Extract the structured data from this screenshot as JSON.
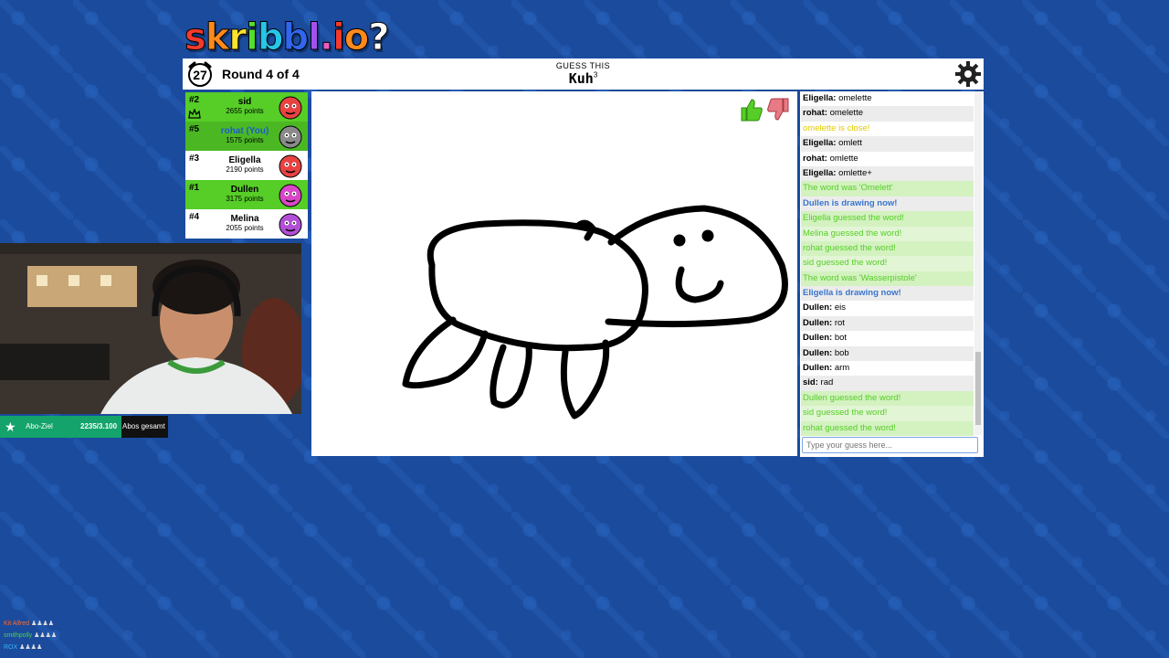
{
  "logo": {
    "letters": [
      {
        "ch": "s",
        "color": "#f33a2b"
      },
      {
        "ch": "k",
        "color": "#ff8a1c"
      },
      {
        "ch": "r",
        "color": "#ffe22b"
      },
      {
        "ch": "i",
        "color": "#52e02b"
      },
      {
        "ch": "b",
        "color": "#27c5e8"
      },
      {
        "ch": "b",
        "color": "#3167ee"
      },
      {
        "ch": "l",
        "color": "#a64ff0"
      },
      {
        "ch": ".",
        "color": "#ee5cc3"
      },
      {
        "ch": "i",
        "color": "#f33a2b"
      },
      {
        "ch": "o",
        "color": "#ff8a1c"
      },
      {
        "ch": "?",
        "color": "#ffffff"
      }
    ]
  },
  "header": {
    "timer": "27",
    "round": "Round 4 of 4",
    "guess_label": "GUESS THIS",
    "word": "Kuh",
    "word_length": "3"
  },
  "players": [
    {
      "rank": "#2",
      "name": "sid",
      "points": "2655 points",
      "bg": "#56ce27",
      "avatar": "#e94242",
      "crown": true,
      "you": false
    },
    {
      "rank": "#5",
      "name": "rohat (You)",
      "points": "1575 points",
      "bg": "#4bb823",
      "avatar": "#8a8a8a",
      "crown": false,
      "you": true
    },
    {
      "rank": "#3",
      "name": "Eligella",
      "points": "2190 points",
      "bg": "#ffffff",
      "avatar": "#e94242",
      "crown": false,
      "you": false
    },
    {
      "rank": "#1",
      "name": "Dullen",
      "points": "3175 points",
      "bg": "#56ce27",
      "avatar": "#d946c8",
      "crown": false,
      "you": false
    },
    {
      "rank": "#4",
      "name": "Melina",
      "points": "2055 points",
      "bg": "#ffffff",
      "avatar": "#b24fd6",
      "crown": false,
      "you": false
    }
  ],
  "chat": {
    "messages": [
      {
        "who": "Eligella",
        "text": "omelette",
        "type": "normal"
      },
      {
        "who": "rohat",
        "text": "omelette",
        "type": "normal"
      },
      {
        "who": "",
        "text": "omelette is close!",
        "type": "yellow"
      },
      {
        "who": "Eligella",
        "text": "omlett",
        "type": "normal"
      },
      {
        "who": "rohat",
        "text": "omlette",
        "type": "normal"
      },
      {
        "who": "Eligella",
        "text": "omlette+",
        "type": "normal"
      },
      {
        "who": "",
        "text": "The word was 'Omelett'",
        "type": "green"
      },
      {
        "who": "",
        "text": "Dullen is drawing now!",
        "type": "blue"
      },
      {
        "who": "",
        "text": "Eligella guessed the word!",
        "type": "green"
      },
      {
        "who": "",
        "text": "Melina guessed the word!",
        "type": "green"
      },
      {
        "who": "",
        "text": "rohat guessed the word!",
        "type": "green"
      },
      {
        "who": "",
        "text": "sid guessed the word!",
        "type": "green"
      },
      {
        "who": "",
        "text": "The word was 'Wasserpistole'",
        "type": "green"
      },
      {
        "who": "",
        "text": "Eligella is drawing now!",
        "type": "blue"
      },
      {
        "who": "Dullen",
        "text": "eis",
        "type": "normal"
      },
      {
        "who": "Dullen",
        "text": "rot",
        "type": "normal"
      },
      {
        "who": "Dullen",
        "text": "bot",
        "type": "normal"
      },
      {
        "who": "Dullen",
        "text": "bob",
        "type": "normal"
      },
      {
        "who": "Dullen",
        "text": "arm",
        "type": "normal"
      },
      {
        "who": "sid",
        "text": "rad",
        "type": "normal"
      },
      {
        "who": "",
        "text": "Dullen guessed the word!",
        "type": "green"
      },
      {
        "who": "",
        "text": "sid guessed the word!",
        "type": "green"
      },
      {
        "who": "",
        "text": "rohat guessed the word!",
        "type": "green"
      }
    ],
    "input_placeholder": "Type your guess here..."
  },
  "abo": {
    "label": "Abo-Ziel",
    "count": "2235/3.100",
    "total": "Abos gesamt"
  },
  "bottom_info": [
    {
      "label": "Kit Alfred",
      "color": "#ff6a2b"
    },
    {
      "label": "smithpolly",
      "color": "#4bd14b"
    },
    {
      "label": "ROX",
      "color": "#36b3ff"
    }
  ],
  "colors": {
    "accent_green": "#56ce27",
    "chat_blue": "#3975ce",
    "close_yellow": "#e2cb00",
    "background": "#1b4b9c"
  }
}
